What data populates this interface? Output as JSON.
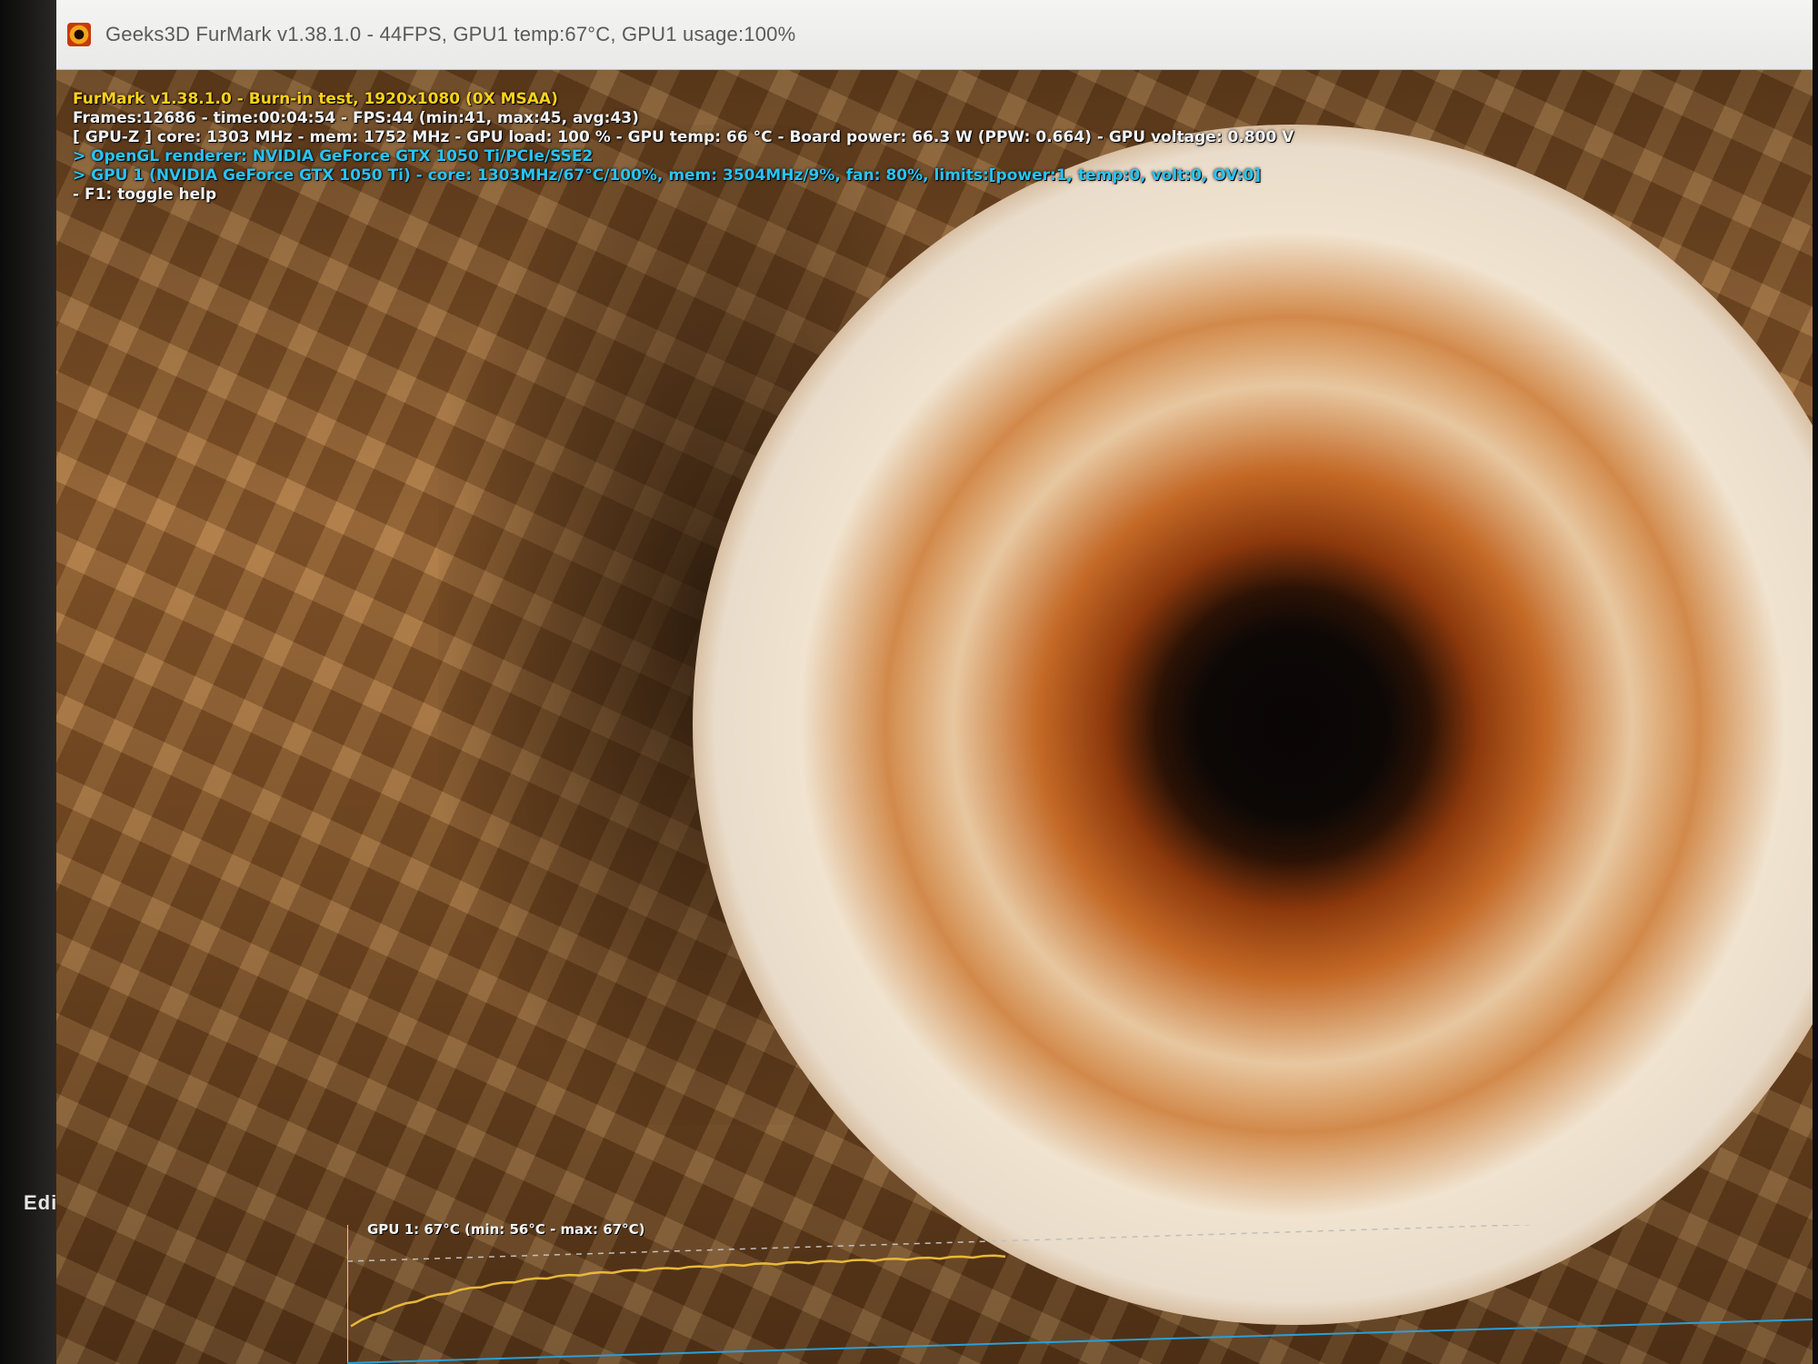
{
  "window": {
    "title": "Geeks3D FurMark v1.38.1.0 - 44FPS, GPU1 temp:67°C, GPU1 usage:100%"
  },
  "hud": {
    "line1": "FurMark v1.38.1.0 - Burn-in test, 1920x1080 (0X MSAA)",
    "line2": "Frames:12686 - time:00:04:54 - FPS:44 (min:41, max:45, avg:43)",
    "line3": "[ GPU-Z ] core: 1303 MHz - mem: 1752 MHz - GPU load: 100 % - GPU temp: 66 °C - Board power: 66.3 W (PPW: 0.664) - GPU voltage: 0.800 V",
    "line4": "> OpenGL renderer: NVIDIA GeForce GTX 1050 Ti/PCIe/SSE2",
    "line5": "> GPU 1 (NVIDIA GeForce GTX 1050 Ti) - core: 1303MHz/67°C/100%, mem: 3504MHz/9%, fan: 80%, limits:[power:1, temp:0, volt:0, OV:0]",
    "line6": "- F1: toggle help"
  },
  "temp_graph": {
    "label": "GPU 1: 67°C (min: 56°C - max: 67°C)",
    "series_color": "#e8b83a",
    "baseline_color": "#2a9fd8",
    "current": 67,
    "min": 56,
    "max": 67
  },
  "bezel": {
    "label": "Edi"
  },
  "colors": {
    "hud_title": "#ffd21a",
    "hud_text": "#f2f2f2",
    "hud_accent": "#28c4f2"
  }
}
